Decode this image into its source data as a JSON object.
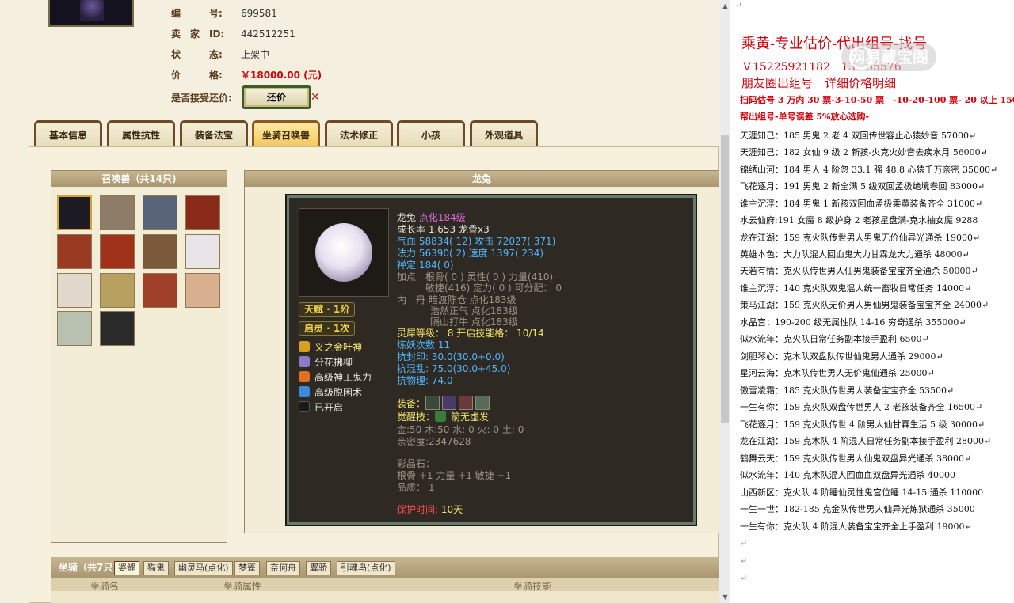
{
  "info": {
    "rows": [
      {
        "label": "编　　　号:",
        "value": "699581"
      },
      {
        "label": "卖　家　ID:",
        "value": "442512251"
      },
      {
        "label": "状　　　态:",
        "value": "上架中"
      },
      {
        "label": "价　　　格:",
        "value": "￥18000.00 (元)"
      },
      {
        "label": "是否接受还价:",
        "value": ""
      }
    ],
    "counter_button": "还价",
    "close_glyph": "✕"
  },
  "tabs": [
    "基本信息",
    "属性抗性",
    "装备法宝",
    "坐骑召唤兽",
    "法术修正",
    "小孩",
    "外观道具"
  ],
  "summon_box_title": "召唤兽（共14只)",
  "detail_box_title": "龙兔",
  "detail": {
    "name": "龙兔",
    "name_suffix": "点化184级",
    "growth": "成长率 1.653 龙骨x3",
    "qixue": "气血 58834( 12) 攻击 72027( 371)",
    "fali": "法力 56390( 2) 速度 1397( 234)",
    "chanding": "禅定 184( 0)",
    "jiadian1": "加点　根骨( 0 ) 灵性( 0 ) 力量(410)",
    "jiadian2": "敏捷(416) 定力( 0 ) 可分配： 0",
    "neidan1": "内　丹 暗渡陈仓 点化183级",
    "neidan2": "浩然正气 点化183级",
    "neidan3": "隔山打牛 点化183级",
    "lingxi": "灵犀等级： 8 开启技能格： 10/14",
    "lianyao": "炼妖次数 11",
    "kanghun": "抗封印: 30.0(30.0+0.0)",
    "kanghunluan": "抗混乱: 75.0(30.0+45.0)",
    "kangwuli": "抗物理: 74.0",
    "tianfu": "天赋 · 1阶",
    "qiling": "启灵 · 1次",
    "skills": [
      "义之金叶神",
      "分花拂柳",
      "高级神工鬼力",
      "高级脱困术",
      "已开启"
    ],
    "equip_label": "装备：",
    "juexing_label": "觉醒技：",
    "juexing_value": "箭无虚发",
    "wuxing": "金:50 木:50 水: 0 火: 0 土: 0",
    "qinmi": "亲密度:2347628",
    "caijing_label": "彩晶石：",
    "caijing_value": "根骨 +1 力量 +1 敏捷 +1",
    "pinzhi": "品质： 1",
    "protect_label": "保护时间:",
    "protect_value": "10天"
  },
  "mount": {
    "label": "坐骑（共7只)",
    "tabs": [
      "婆鲤",
      "猫鬼",
      "幽灵马(点化)",
      "梦蓬",
      "奈何舟",
      "翼骄",
      "引魂鸟(点化)"
    ],
    "headers": [
      "坐骑名",
      "坐骑属性",
      "坐骑技能"
    ]
  },
  "right": {
    "title": "乘黄-专业估价-代出组号-找号",
    "contact": "Ｖ15225921182　13",
    "contact_tail": "55576",
    "subtitle": "朋友圈出组号　详细价格明细",
    "promo1": "扫码估号 3 万内 30 票-3-10-50 票　-10-20-100 票- 20 以上 150",
    "promo2": "帮出组号-单号误差 5%放心选购-",
    "listings": [
      "天涯知己：185 男鬼 2 老 4 双回传世容止心猿妙音 57000↵",
      "天涯知己：182 女仙 9 级 2 新孩-火克火妙音去疾水月 56000↵",
      "锦绣山河：184 男人 4 阶忽 33.1 强 48.8 心猿千万亲密 35000↵",
      "飞花逐月：191 男鬼 2 新全满 5 级双回孟极绝境春回 83000↵",
      "谁主沉浮：184 男鬼 1 新孩双回血孟极乘黄装备齐全 31000↵",
      "水云仙府:191 女魔 8 级护身 2 老孩星盘满-克水抽女魔 9288",
      "龙在江湖：159 克火队传世男人男鬼无价仙异光通杀 19000↵",
      "英雄本色：大力队混人回血鬼大力甘霖龙大力通杀 48000↵",
      "天若有情：克火队传世男人仙男鬼装备宝宝齐全通杀 50000↵",
      "谁主沉浮：140 克火队双鬼混人统一畜牧日常任务 14000↵",
      "策马江湖：159 克火队无价男人男仙男鬼装备宝宝齐全 24000↵",
      "水晶宫：190-200 级无属性队 14-16 穷奇通杀 355000↵",
      "似水流年：克火队日常任务副本接手盈利 6500↵",
      "剑胆琴心：克木队双盘队传世仙鬼男人通杀 29000↵",
      "星河云海：克木队传世男人无价鬼仙通杀 25000↵",
      "傲雪凌霜：185 克火队传世男人装备宝宝齐全 53500↵",
      "一生有你：159 克火队双盘传世男人 2 老孩装备齐全 16500↵",
      "飞花逐月：159 克火队传世 4 阶男人仙甘霖生活 5 级 30000↵",
      "龙在江湖：159 克木队 4 阶混人日常任务副本接手盈利 28000↵",
      "鹤舞云天：159 克火队传世男人仙鬼双盘异光通杀 38000↵",
      "似水流年：140 克木队混人回血血双盘异光通杀 40000",
      "山西新区：克火队 4 阶睡仙灵性鬼宫位睡 14-15 通杀 110000",
      "一生一世：182-185 克金队传世男人仙异光炼狱通杀 35000",
      "一生有你：克火队 4 阶混人装备宝宝齐全上手盈利 19000↵",
      "↵",
      "↵",
      "↵"
    ]
  },
  "colors": {
    "accent_red": "#d4000c",
    "panel_bg": "#2e2a23"
  }
}
